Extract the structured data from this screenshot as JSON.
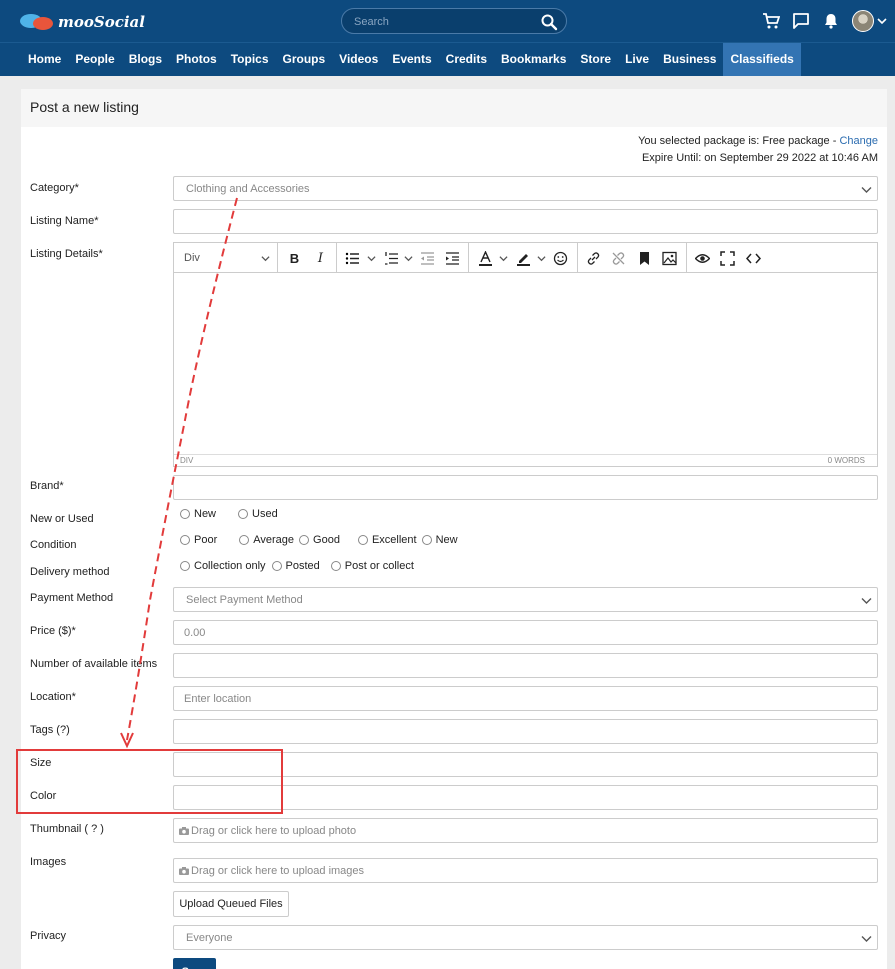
{
  "brand": {
    "logo_text": "mooSocial"
  },
  "search": {
    "placeholder": "Search"
  },
  "top_icons": [
    "cart-icon",
    "chat-icon",
    "bell-icon",
    "avatar",
    "chevron-down-icon"
  ],
  "nav": {
    "items": [
      "Home",
      "People",
      "Blogs",
      "Photos",
      "Topics",
      "Groups",
      "Videos",
      "Events",
      "Credits",
      "Bookmarks",
      "Store",
      "Live",
      "Business",
      "Classifieds"
    ],
    "active": "Classifieds"
  },
  "page": {
    "title": "Post a new listing",
    "package_text": "You selected package is: Free package - ",
    "package_change": "Change",
    "expire_text": "Expire Until: on September 29 2022 at 10:46 AM"
  },
  "form": {
    "category": {
      "label": "Category*",
      "value": "Clothing and Accessories"
    },
    "listing_name": {
      "label": "Listing Name*",
      "value": ""
    },
    "listing_details": {
      "label": "Listing Details*",
      "format": "Div",
      "status_path": "DIV",
      "word_count": "0 WORDS"
    },
    "brand": {
      "label": "Brand*",
      "value": ""
    },
    "new_or_used": {
      "label": "New or Used",
      "options": [
        "New",
        "Used"
      ]
    },
    "condition": {
      "label": "Condition",
      "options": [
        "Poor",
        "Average",
        "Good",
        "Excellent",
        "New"
      ]
    },
    "delivery": {
      "label": "Delivery method",
      "options": [
        "Collection only",
        "Posted",
        "Post or collect"
      ]
    },
    "payment": {
      "label": "Payment Method",
      "placeholder": "Select Payment Method"
    },
    "price": {
      "label": "Price ($)*",
      "placeholder": "0.00"
    },
    "available_items": {
      "label": "Number of available items",
      "value": ""
    },
    "location": {
      "label": "Location*",
      "placeholder": "Enter location"
    },
    "tags": {
      "label": "Tags (?)",
      "value": ""
    },
    "size": {
      "label": "Size",
      "value": ""
    },
    "color": {
      "label": "Color",
      "value": ""
    },
    "thumbnail": {
      "label": "Thumbnail ( ? )",
      "upload_text": "Drag or click here to upload photo"
    },
    "images": {
      "label": "Images",
      "upload_text": "Drag or click here to upload images"
    },
    "upload_button": "Upload Queued Files",
    "privacy": {
      "label": "Privacy",
      "value": "Everyone"
    },
    "save_button": "Save"
  },
  "colors": {
    "header_bg": "#0d4a7f",
    "nav_active": "#3374b3",
    "annotation": "#e23b3b"
  }
}
